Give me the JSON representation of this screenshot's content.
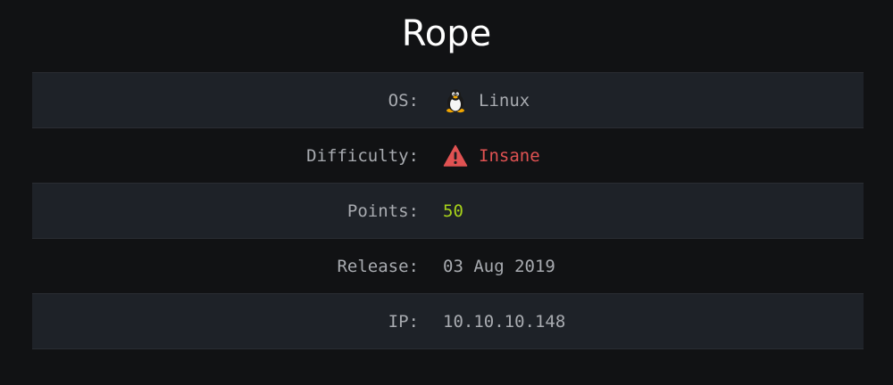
{
  "title": "Rope",
  "rows": [
    {
      "label": "OS:",
      "value": "Linux",
      "icon": "linux-penguin-icon"
    },
    {
      "label": "Difficulty:",
      "value": "Insane",
      "icon": "warning-icon",
      "value_color": "#e05252"
    },
    {
      "label": "Points:",
      "value": "50",
      "value_color": "#a7d21a"
    },
    {
      "label": "Release:",
      "value": "03 Aug 2019"
    },
    {
      "label": "IP:",
      "value": "10.10.10.148"
    }
  ]
}
